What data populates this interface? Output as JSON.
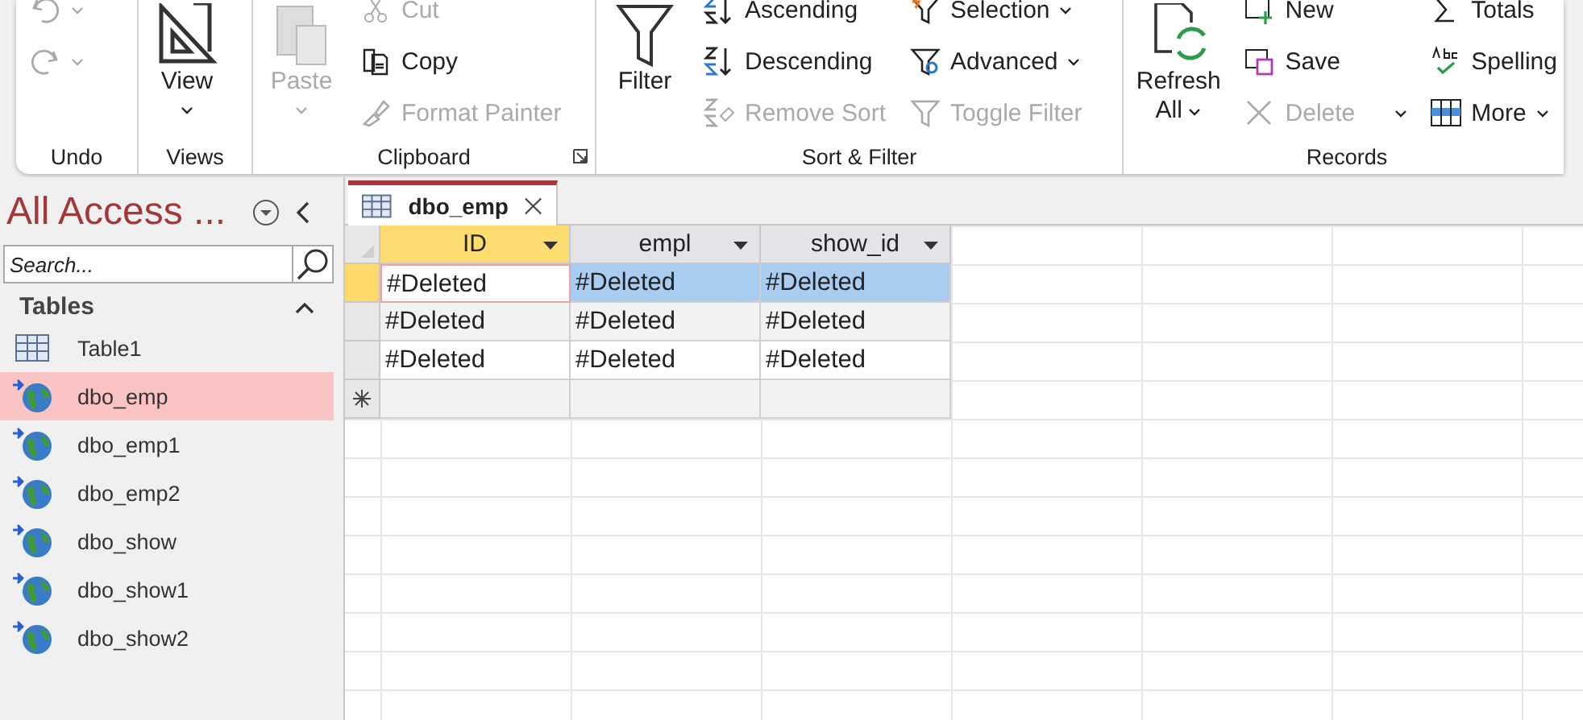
{
  "ribbon": {
    "groups": [
      {
        "label": "Undo",
        "columns": [
          [
            {
              "disabled": true,
              "caret": true
            },
            {
              "disabled": true,
              "caret": true
            }
          ]
        ]
      },
      {
        "label": "Views",
        "large": [
          {
            "label": "View",
            "disabled": false,
            "caret": true
          }
        ]
      },
      {
        "label": "Clipboard",
        "large": [
          {
            "label": "Paste",
            "disabled": true,
            "caret": true
          }
        ],
        "columns": [
          [
            {
              "label": "Cut",
              "disabled": true,
              "caret": false
            },
            {
              "label": "Copy",
              "disabled": false,
              "caret": false
            },
            {
              "label": "Format Painter",
              "disabled": true,
              "caret": false
            }
          ]
        ],
        "launcher": true
      },
      {
        "label": "Sort & Filter",
        "large": [
          {
            "label": "Filter",
            "disabled": false,
            "caret": false
          }
        ],
        "columns": [
          [
            {
              "label": "Ascending",
              "disabled": false,
              "caret": false
            },
            {
              "label": "Descending",
              "disabled": false,
              "caret": false
            },
            {
              "label": "Remove Sort",
              "disabled": true,
              "caret": false
            }
          ],
          [
            {
              "label": "Selection",
              "disabled": false,
              "caret": true
            },
            {
              "label": "Advanced",
              "disabled": false,
              "caret": true
            },
            {
              "label": "Toggle Filter",
              "disabled": true,
              "caret": false
            }
          ]
        ]
      },
      {
        "label": "Records",
        "large": [
          {
            "label": "Refresh",
            "label2": "All",
            "disabled": false,
            "caret": true
          }
        ],
        "columns": [
          [
            {
              "label": "New",
              "disabled": false,
              "caret": false
            },
            {
              "label": "Save",
              "disabled": false,
              "caret": false
            },
            {
              "label": "Delete",
              "disabled": true,
              "caret": true
            }
          ],
          [
            {
              "label": "Totals",
              "disabled": false,
              "caret": false
            },
            {
              "label": "Spelling",
              "disabled": false,
              "caret": false
            },
            {
              "label": "More",
              "disabled": false,
              "caret": true
            }
          ]
        ]
      }
    ]
  },
  "nav": {
    "title": "All Access ...",
    "search": {
      "placeholder": "Search..."
    },
    "section": {
      "label": "Tables",
      "expanded": true
    },
    "items": [
      {
        "label": "Table1",
        "kind": "local",
        "selected": false
      },
      {
        "label": "dbo_emp",
        "kind": "linked",
        "selected": true
      },
      {
        "label": "dbo_emp1",
        "kind": "linked",
        "selected": false
      },
      {
        "label": "dbo_emp2",
        "kind": "linked",
        "selected": false
      },
      {
        "label": "dbo_show",
        "kind": "linked",
        "selected": false
      },
      {
        "label": "dbo_show1",
        "kind": "linked",
        "selected": false
      },
      {
        "label": "dbo_show2",
        "kind": "linked",
        "selected": false
      }
    ]
  },
  "datasheet": {
    "tab": {
      "label": "dbo_emp"
    },
    "columns": [
      {
        "label": "ID",
        "current": true
      },
      {
        "label": "empl",
        "current": false
      },
      {
        "label": "show_id",
        "current": false
      }
    ],
    "rows": [
      {
        "current": true,
        "cells": [
          {
            "text": "#Deleted",
            "focused": true,
            "selected": false
          },
          {
            "text": "#Deleted",
            "focused": false,
            "selected": true
          },
          {
            "text": "#Deleted",
            "focused": false,
            "selected": true
          }
        ]
      },
      {
        "current": false,
        "cells": [
          {
            "text": "#Deleted",
            "focused": false,
            "selected": false
          },
          {
            "text": "#Deleted",
            "focused": false,
            "selected": false
          },
          {
            "text": "#Deleted",
            "focused": false,
            "selected": false
          }
        ]
      },
      {
        "current": false,
        "cells": [
          {
            "text": "#Deleted",
            "focused": false,
            "selected": false
          },
          {
            "text": "#Deleted",
            "focused": false,
            "selected": false
          },
          {
            "text": "#Deleted",
            "focused": false,
            "selected": false
          }
        ]
      }
    ]
  }
}
